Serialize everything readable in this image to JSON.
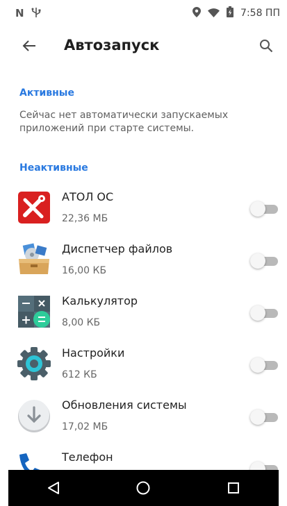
{
  "status_bar": {
    "left_icons": [
      "n-icon",
      "usb-icon"
    ],
    "right_icons": [
      "location-icon",
      "wifi-icon",
      "battery-icon"
    ],
    "time": "7:58 ПП"
  },
  "app_bar": {
    "title": "Автозапуск",
    "back_icon": "arrow-left-icon",
    "search_icon": "search-icon"
  },
  "sections": {
    "active": {
      "label": "Активные",
      "empty_message": "Сейчас нет автоматически запускаемых приложений при старте системы."
    },
    "inactive": {
      "label": "Неактивные"
    }
  },
  "apps": [
    {
      "name": "АТОЛ ОС",
      "size": "22,36 МБ",
      "icon": "atol-tools-icon",
      "enabled": false
    },
    {
      "name": "Диспетчер файлов",
      "size": "16,00 КБ",
      "icon": "file-manager-icon",
      "enabled": false
    },
    {
      "name": "Калькулятор",
      "size": "8,00 КБ",
      "icon": "calculator-icon",
      "enabled": false
    },
    {
      "name": "Настройки",
      "size": "612 КБ",
      "icon": "settings-gear-icon",
      "enabled": false
    },
    {
      "name": "Обновления системы",
      "size": "17,02 МБ",
      "icon": "system-update-icon",
      "enabled": false
    },
    {
      "name": "Телефон",
      "size": "",
      "icon": "phone-icon",
      "enabled": false
    }
  ],
  "nav_bar": {
    "buttons": [
      "back-triangle-icon",
      "home-circle-icon",
      "recents-square-icon"
    ]
  },
  "colors": {
    "accent": "#2979e0",
    "nav_bar": "#000000",
    "toggle_off_track": "#b9b9b9",
    "toggle_off_thumb": "#f6f6f6"
  }
}
